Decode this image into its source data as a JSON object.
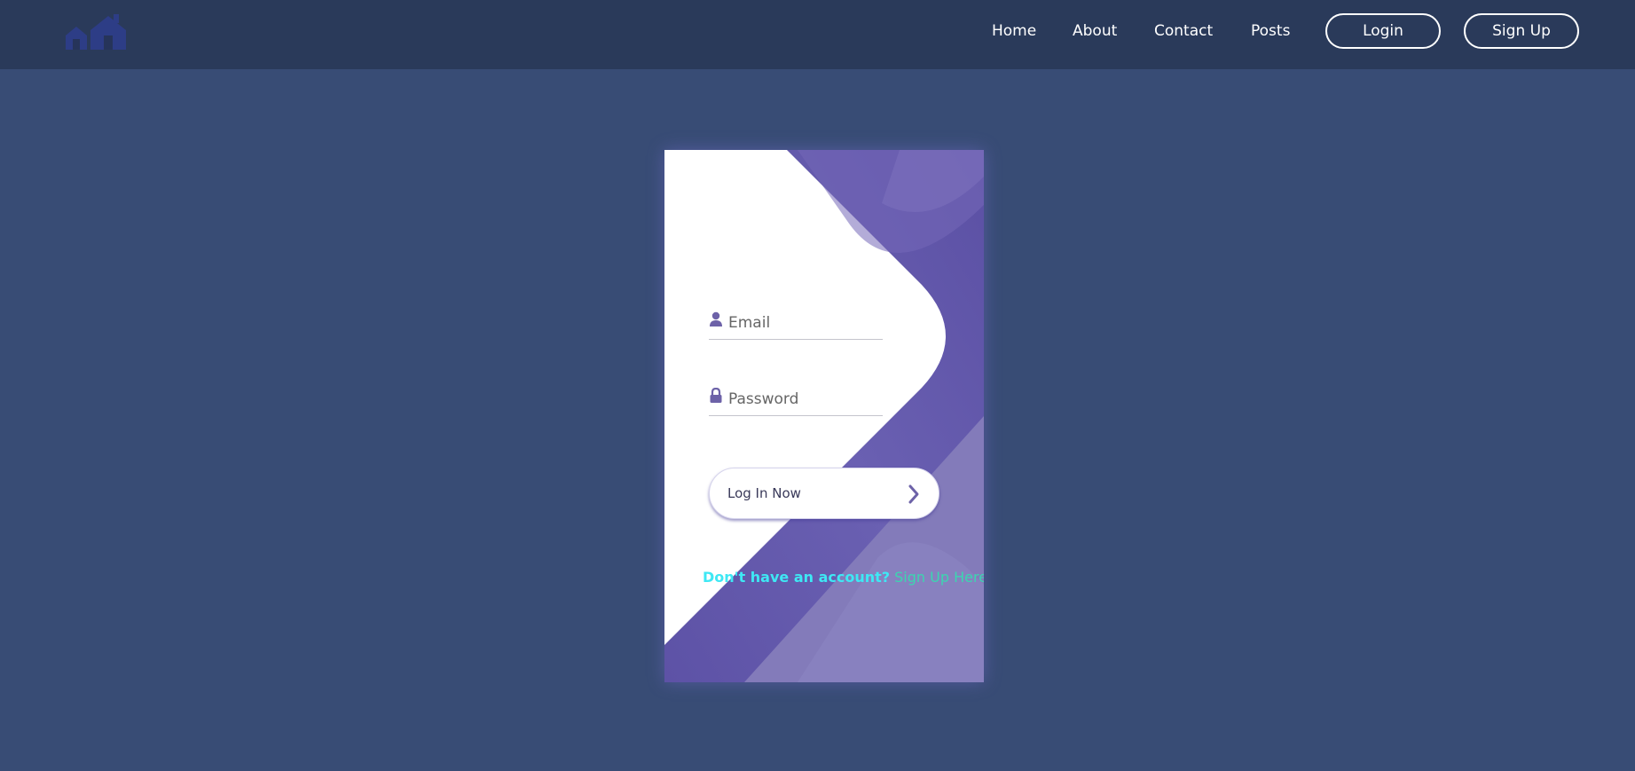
{
  "navbar": {
    "logo_icon": "house-logo-icon",
    "links": [
      {
        "label": "Home"
      },
      {
        "label": "About"
      },
      {
        "label": "Contact"
      },
      {
        "label": "Posts"
      }
    ],
    "login_label": "Login",
    "signup_label": "Sign Up"
  },
  "login_card": {
    "email": {
      "icon": "user-icon",
      "placeholder": "Email",
      "value": ""
    },
    "password": {
      "icon": "lock-icon",
      "placeholder": "Password",
      "value": ""
    },
    "submit_label": "Log In Now",
    "submit_icon": "chevron-right-icon",
    "signup_prompt": "Don't have an account?",
    "signup_link": "Sign Up Here"
  },
  "colors": {
    "page_background": "#384c75",
    "navbar_background": "#2a3a5a",
    "card_accent": "#6457a8",
    "prompt_text": "#3ee8f4",
    "link_text": "#3bd6b0"
  }
}
